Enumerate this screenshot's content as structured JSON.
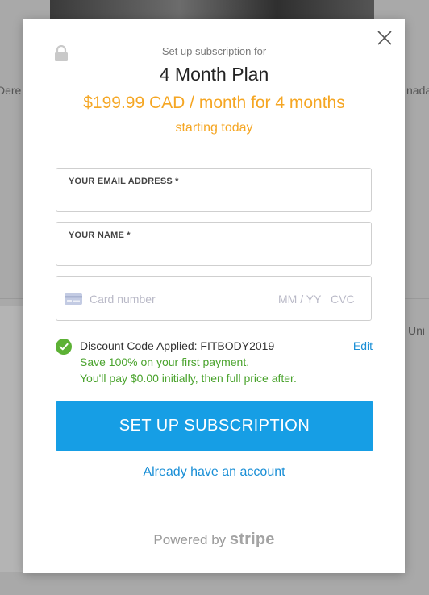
{
  "background": {
    "left_text": "Dere",
    "right_text": "nada",
    "right_text2": "Uni"
  },
  "modal": {
    "setup_label": "Set up subscription for",
    "plan_name": "4 Month Plan",
    "price_line": "$199.99 CAD / month for 4 months",
    "starting_line": "starting today",
    "email_field": {
      "label": "YOUR EMAIL ADDRESS *",
      "value": ""
    },
    "name_field": {
      "label": "YOUR NAME *",
      "value": ""
    },
    "card": {
      "number_placeholder": "Card number",
      "expiry_placeholder": "MM / YY",
      "cvc_placeholder": "CVC"
    },
    "discount": {
      "applied_text": "Discount Code Applied: FITBODY2019",
      "edit_label": "Edit",
      "line1": "Save 100% on your first payment.",
      "line2": "You'll pay $0.00 initially, then full price after."
    },
    "submit_label": "SET UP SUBSCRIPTION",
    "account_link": "Already have an account",
    "powered_by": "Powered by",
    "stripe_brand": "stripe"
  },
  "colors": {
    "accent_orange": "#f5a623",
    "button_blue": "#169ee5",
    "link_blue": "#1a8fd6",
    "success_green": "#4aa32d"
  }
}
